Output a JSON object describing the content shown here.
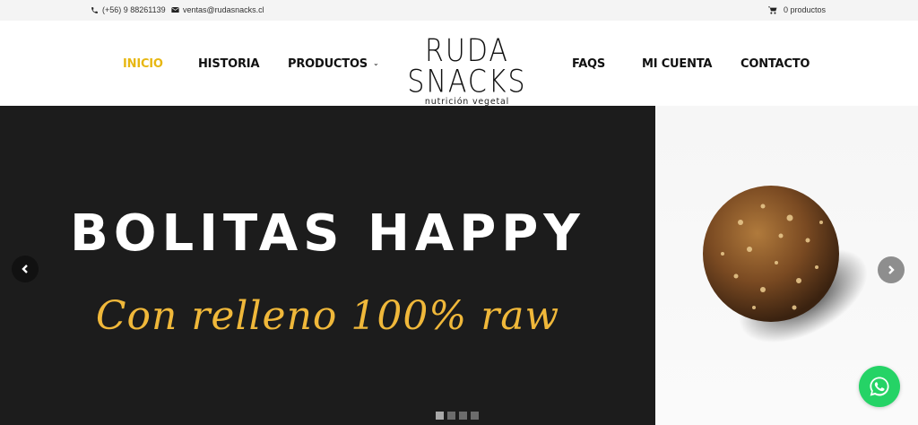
{
  "topbar": {
    "phone": "(+56) 9 88261139",
    "email": "ventas@rudasnacks.cl",
    "cart": "0 productos"
  },
  "nav": {
    "inicio": "INICIO",
    "historia": "HISTORIA",
    "productos": "PRODUCTOS",
    "faqs": "FAQS",
    "mi_cuenta": "MI CUENTA",
    "contacto": "CONTACTO"
  },
  "logo": {
    "brand": "RUDA SNACKS",
    "tagline": "nutrición vegetal"
  },
  "hero": {
    "headline": "BOLITAS HAPPY",
    "subheadline": "Con relleno 100% raw",
    "image": "energy-ball-photo"
  },
  "slider": {
    "slide_count": 4,
    "active_slide": 1
  },
  "colors": {
    "accent": "#e7b712",
    "hero_bg": "#1c1c1c",
    "subheadline": "#f0b83a",
    "whatsapp": "#25d366",
    "topbar_bg": "#f4f4f4"
  },
  "icons": [
    "phone-icon",
    "mail-icon",
    "cart-icon",
    "chevron-down-icon",
    "chevron-left-icon",
    "chevron-right-icon",
    "whatsapp-icon"
  ]
}
